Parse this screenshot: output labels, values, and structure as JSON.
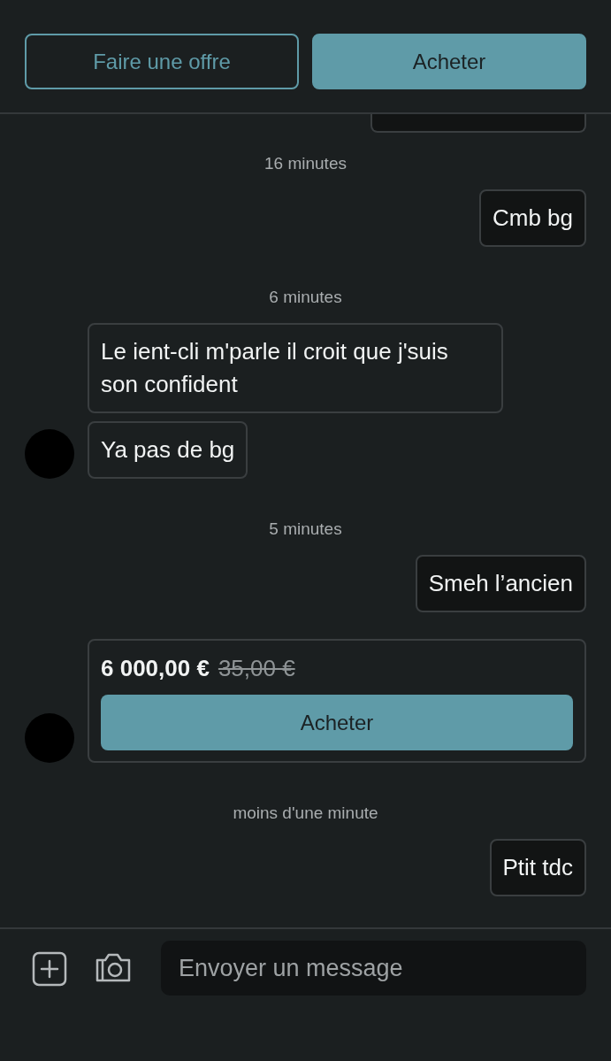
{
  "header": {
    "buttons": [
      {
        "label": "Faire une offre",
        "kind": "outline"
      },
      {
        "label": "Acheter",
        "kind": "primary"
      }
    ]
  },
  "messages": [
    {
      "kind": "timestamp",
      "text": "16 minutes"
    },
    {
      "kind": "outgoing",
      "text": "Cmb bg"
    },
    {
      "kind": "timestamp",
      "text": "6 minutes"
    },
    {
      "kind": "incoming",
      "text": "Le ient-cli m'parle il croit que j'suis son confident",
      "avatar": false
    },
    {
      "kind": "incoming",
      "text": "Ya pas de bg",
      "avatar": true
    },
    {
      "kind": "timestamp",
      "text": "5 minutes"
    },
    {
      "kind": "outgoing",
      "text": "Smeh l’ancien"
    },
    {
      "kind": "offer",
      "price": "6 000,00 €",
      "old_price": "35,00 €",
      "button": "Acheter",
      "avatar": true
    },
    {
      "kind": "timestamp",
      "text": "moins d'une minute"
    },
    {
      "kind": "outgoing",
      "text": "Ptit tdc"
    }
  ],
  "composer": {
    "placeholder": "Envoyer un message"
  }
}
